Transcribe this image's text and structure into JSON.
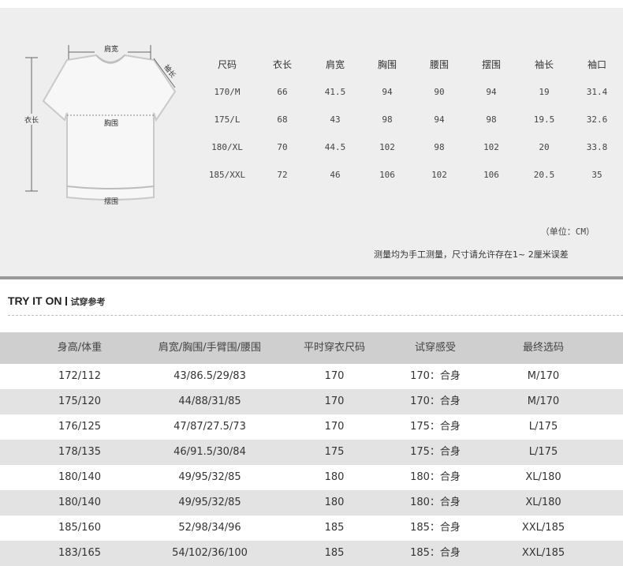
{
  "diagram": {
    "shoulder_label": "肩宽",
    "sleeve_label": "袖长",
    "length_label": "衣长",
    "chest_label": "胸围",
    "hem_label": "摆围"
  },
  "size_chart": {
    "columns": [
      "尺码",
      "衣长",
      "肩宽",
      "胸围",
      "腰围",
      "摆围",
      "袖长",
      "袖口"
    ],
    "rows": [
      [
        "170/M",
        "66",
        "41.5",
        "94",
        "90",
        "94",
        "19",
        "31.4"
      ],
      [
        "175/L",
        "68",
        "43",
        "98",
        "94",
        "98",
        "19.5",
        "32.6"
      ],
      [
        "180/XL",
        "70",
        "44.5",
        "102",
        "98",
        "102",
        "20",
        "33.8"
      ],
      [
        "185/XXL",
        "72",
        "46",
        "106",
        "102",
        "106",
        "20.5",
        "35"
      ]
    ],
    "unit_note": "（单位：CM）",
    "measure_note": "测量均为手工测量，尺寸请允许存在1~ 2厘米误差"
  },
  "try_on": {
    "title_en": "TRY IT ON",
    "title_cn": "试穿参考",
    "columns": [
      "身高/体重",
      "肩宽/胸围/手臂围/腰围",
      "平时穿衣尺码",
      "试穿感受",
      "最终选码"
    ],
    "rows": [
      [
        "172/112",
        "43/86.5/29/83",
        "170",
        "170：合身",
        "M/170"
      ],
      [
        "175/120",
        "44/88/31/85",
        "170",
        "170：合身",
        "M/170"
      ],
      [
        "176/125",
        "47/87/27.5/73",
        "170",
        "175：合身",
        "L/175"
      ],
      [
        "178/135",
        "46/91.5/30/84",
        "175",
        "175：合身",
        "L/175"
      ],
      [
        "180/140",
        "49/95/32/85",
        "180",
        "180：合身",
        "XL/180"
      ],
      [
        "180/140",
        "49/95/32/85",
        "180",
        "180：合身",
        "XL/180"
      ],
      [
        "185/160",
        "52/98/34/96",
        "185",
        "185：合身",
        "XXL/185"
      ],
      [
        "183/165",
        "54/102/36/100",
        "185",
        "185：合身",
        "XXL/185"
      ]
    ]
  }
}
